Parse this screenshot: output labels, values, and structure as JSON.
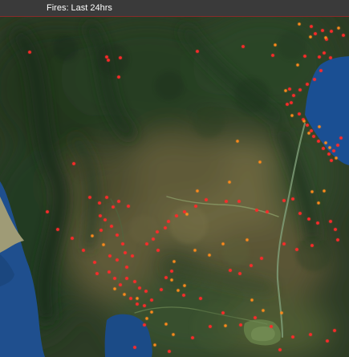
{
  "map": {
    "title": "Fires: Last 24hrs",
    "basemap": "satellite-imagery",
    "colors": {
      "title_bar": "#3a3a3a",
      "title_text": "#ffffff",
      "title_accent": "#8a2a2a",
      "fire_red": "#ff2a2a",
      "fire_orange": "#ff8a1a",
      "water": "#1d4f8c",
      "vegetation": "#2d4a28",
      "plain": "#6e6741"
    }
  }
}
